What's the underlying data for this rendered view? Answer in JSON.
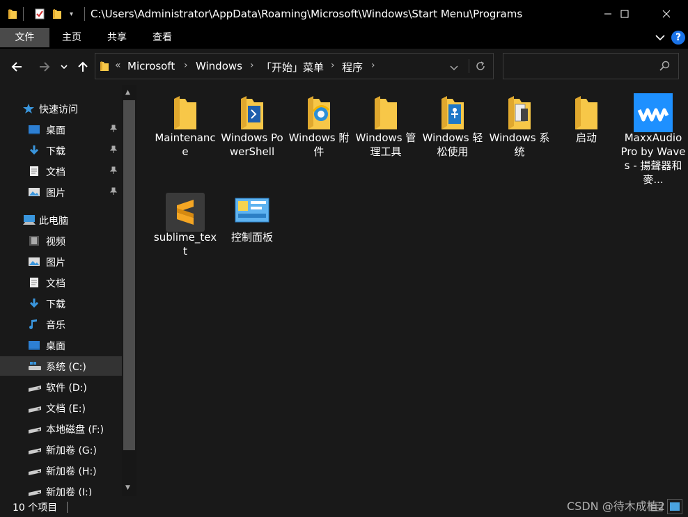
{
  "window": {
    "title": "C:\\Users\\Administrator\\AppData\\Roaming\\Microsoft\\Windows\\Start Menu\\Programs",
    "min_icon": "minimize-icon",
    "max_icon": "maximize-icon",
    "close_icon": "close-icon"
  },
  "ribbon": {
    "tabs": [
      {
        "label": "文件"
      },
      {
        "label": "主页"
      },
      {
        "label": "共享"
      },
      {
        "label": "查看"
      }
    ]
  },
  "address": {
    "overflow": "«",
    "crumbs": [
      "Microsoft",
      "Windows",
      "「开始」菜单",
      "程序"
    ]
  },
  "search": {
    "placeholder": ""
  },
  "sidebar": {
    "items": [
      {
        "label": "快速访问",
        "icon": "star-icon"
      },
      {
        "label": "桌面",
        "icon": "desktop-icon",
        "pinned": true
      },
      {
        "label": "下载",
        "icon": "download-icon",
        "pinned": true
      },
      {
        "label": "文档",
        "icon": "document-icon",
        "pinned": true
      },
      {
        "label": "图片",
        "icon": "picture-icon",
        "pinned": true
      },
      {
        "label": "此电脑",
        "icon": "computer-icon"
      },
      {
        "label": "视频",
        "icon": "video-icon"
      },
      {
        "label": "图片",
        "icon": "picture-icon"
      },
      {
        "label": "文档",
        "icon": "document-icon"
      },
      {
        "label": "下载",
        "icon": "download-icon"
      },
      {
        "label": "音乐",
        "icon": "music-icon"
      },
      {
        "label": "桌面",
        "icon": "desktop-icon"
      },
      {
        "label": "系统 (C:)",
        "icon": "system-drive-icon",
        "selected": true
      },
      {
        "label": "软件 (D:)",
        "icon": "drive-icon"
      },
      {
        "label": "文档 (E:)",
        "icon": "drive-icon"
      },
      {
        "label": "本地磁盘 (F:)",
        "icon": "drive-icon"
      },
      {
        "label": "新加卷 (G:)",
        "icon": "drive-icon"
      },
      {
        "label": "新加卷 (H:)",
        "icon": "drive-icon"
      },
      {
        "label": "新加卷 (I:)",
        "icon": "drive-icon"
      }
    ]
  },
  "files": [
    {
      "name": "Maintenance",
      "icon": "folder-icon"
    },
    {
      "name": "Windows PowerShell",
      "icon": "powershell-folder-icon"
    },
    {
      "name": "Windows 附件",
      "icon": "ie-folder-icon"
    },
    {
      "name": "Windows 管理工具",
      "icon": "folder-icon"
    },
    {
      "name": "Windows 轻松使用",
      "icon": "accessibility-folder-icon"
    },
    {
      "name": "Windows 系统",
      "icon": "system-folder-icon"
    },
    {
      "name": "启动",
      "icon": "folder-icon"
    },
    {
      "name": "MaxxAudio Pro by Waves - 揚聲器和麥...",
      "icon": "waves-app-icon"
    },
    {
      "name": "sublime_text",
      "icon": "sublime-text-icon"
    },
    {
      "name": "控制面板",
      "icon": "control-panel-icon"
    }
  ],
  "status": {
    "count_text": "10 个项目"
  },
  "watermark": "CSDN @待木成植2",
  "colors": {
    "background": "#191919",
    "accent": "#1e90ff",
    "folder": "#f7c748"
  }
}
